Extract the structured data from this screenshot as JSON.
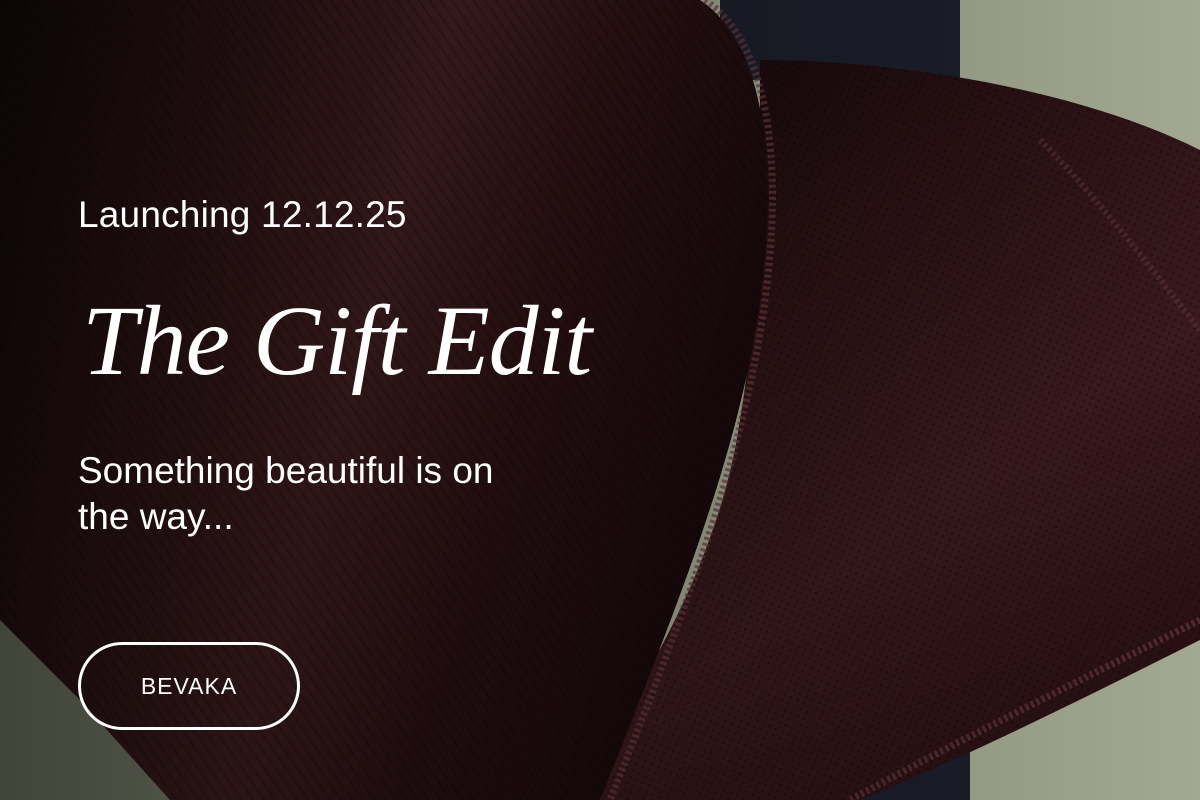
{
  "hero": {
    "eyebrow": "Launching 12.12.25",
    "title": "The Gift Edit",
    "subtitle": "Something beautiful is on the way...",
    "cta_label": "BEVAKA"
  },
  "colors": {
    "ribbon": "#3a1a1c",
    "ribbon_dark": "#1a0a0c",
    "paper_sage": "#9ea58d",
    "band_navy": "#1b1e2a",
    "text": "#ffffff"
  },
  "background": {
    "image": "burgundy-satin-ribbon-on-sage-gift-paper"
  }
}
